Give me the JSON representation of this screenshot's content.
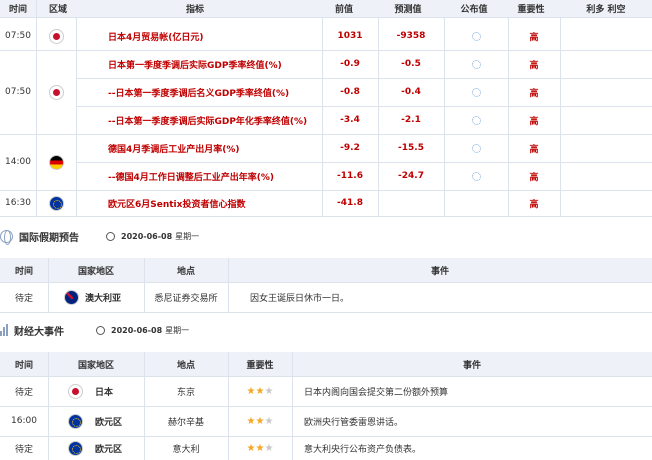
{
  "calendar": {
    "headers": {
      "time": "时间",
      "region": "区域",
      "indicator": "指标",
      "previous": "前值",
      "forecast": "预测值",
      "actual": "公布值",
      "importance": "重要性",
      "effect": "利多 利空"
    },
    "rows": [
      {
        "time": "07:50",
        "flag": "japan-flag",
        "indicator": "日本4月贸易帐(亿日元)",
        "previous": "1031",
        "forecast": "-9358",
        "importance": "高"
      },
      {
        "time": "07:50",
        "flag": "japan-flag",
        "indicator": "日本第一季度季调后实际GDP季率终值(%)",
        "previous": "-0.9",
        "forecast": "-0.5",
        "importance": "高"
      },
      {
        "time": "",
        "flag": "",
        "indicator": "--日本第一季度季调后名义GDP季率终值(%)",
        "previous": "-0.8",
        "forecast": "-0.4",
        "importance": "高"
      },
      {
        "time": "",
        "flag": "",
        "indicator": "--日本第一季度季调后实际GDP年化季率终值(%)",
        "previous": "-3.4",
        "forecast": "-2.1",
        "importance": "高"
      },
      {
        "time": "14:00",
        "flag": "germany-flag",
        "indicator": "德国4月季调后工业产出月率(%)",
        "previous": "-9.2",
        "forecast": "-15.5",
        "importance": "高"
      },
      {
        "time": "",
        "flag": "",
        "indicator": "--德国4月工作日调整后工业产出年率(%)",
        "previous": "-11.6",
        "forecast": "-24.7",
        "importance": "高"
      },
      {
        "time": "16:30",
        "flag": "eu-flag",
        "indicator": "欧元区6月Sentix投资者信心指数",
        "previous": "-41.8",
        "forecast": "",
        "importance": "高"
      }
    ]
  },
  "holidays": {
    "title": "国际假期预告",
    "date": "2020-06-08",
    "weekday": "星期一",
    "headers": {
      "time": "时间",
      "country": "国家地区",
      "place": "地点",
      "event": "事件"
    },
    "rows": [
      {
        "time": "待定",
        "flag": "australia-flag",
        "country": "澳大利亚",
        "place": "悉尼证券交易所",
        "event": "因女王诞辰日休市一日。"
      }
    ]
  },
  "events": {
    "title": "财经大事件",
    "date": "2020-06-08",
    "weekday": "星期一",
    "headers": {
      "time": "时间",
      "country": "国家地区",
      "place": "地点",
      "importance": "重要性",
      "event": "事件"
    },
    "rows": [
      {
        "time": "待定",
        "flag": "japan-flag",
        "country": "日本",
        "place": "东京",
        "stars": 2,
        "event": "日本内阁向国会提交第二份额外预算"
      },
      {
        "time": "16:00",
        "flag": "eu-flag",
        "country": "欧元区",
        "place": "赫尔辛基",
        "stars": 2,
        "event": "欧洲央行管委雷恩讲话。"
      },
      {
        "time": "待定",
        "flag": "eu-flag",
        "country": "欧元区",
        "place": "意大利",
        "stars": 2,
        "event": "意大利央行公布资产负债表。"
      }
    ]
  }
}
